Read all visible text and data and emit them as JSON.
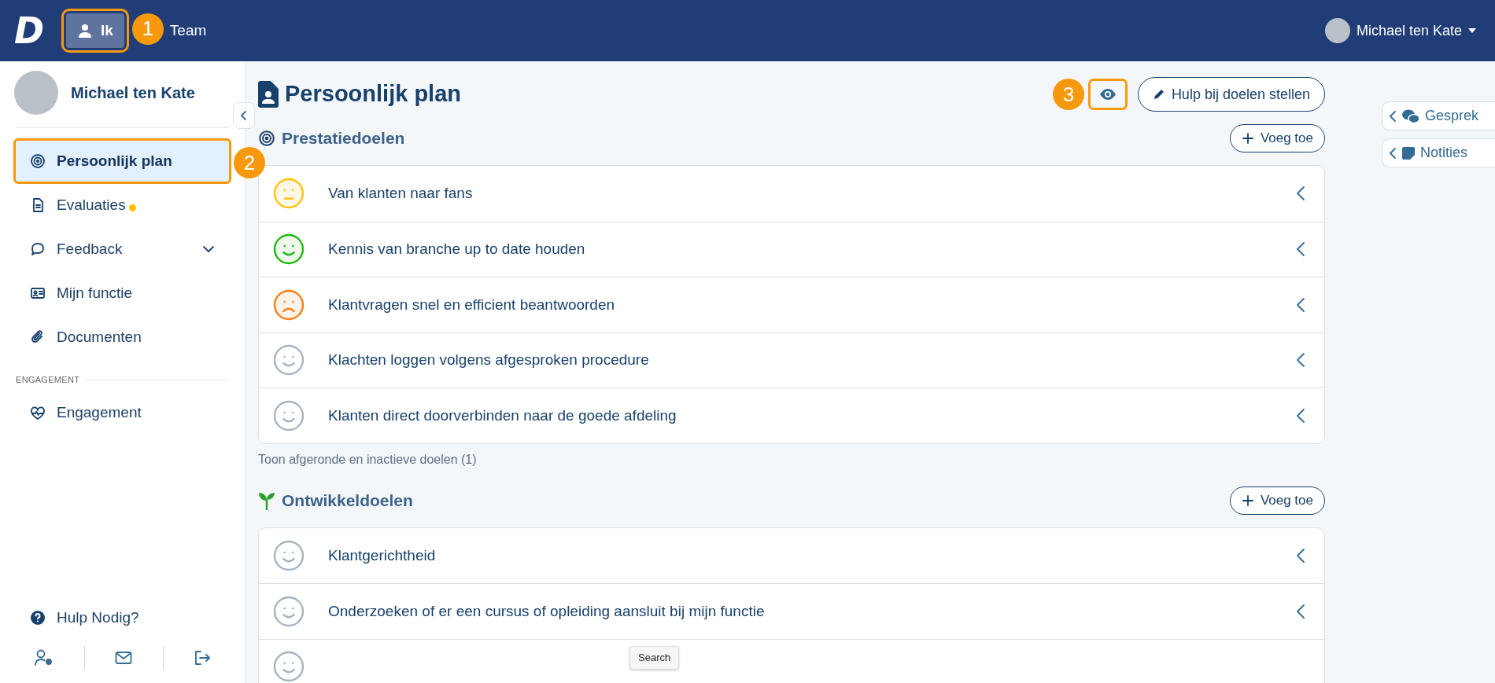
{
  "topbar": {
    "logo": "D",
    "nav": [
      {
        "label": "Ik",
        "selected": true,
        "highlighted": true
      },
      {
        "label": "Team",
        "selected": false
      }
    ],
    "user": {
      "name": "Michael ten Kate"
    }
  },
  "sidebar": {
    "profile_name": "Michael ten Kate",
    "sections": [
      {
        "items": [
          {
            "label": "Persoonlijk plan",
            "selected": true,
            "highlighted": true,
            "notification": false
          },
          {
            "label": "Evaluaties",
            "selected": false,
            "highlighted": false,
            "notification": true
          },
          {
            "label": "Feedback",
            "selected": false,
            "highlighted": false,
            "notification": false,
            "kind": "group",
            "expanded": false
          },
          {
            "label": "Mijn functie",
            "selected": false,
            "highlighted": false,
            "notification": false
          },
          {
            "label": "Documenten",
            "selected": false,
            "highlighted": false,
            "notification": false
          }
        ]
      },
      {
        "label": "ENGAGEMENT",
        "items": [
          {
            "label": "Engagement",
            "selected": false,
            "highlighted": false,
            "notification": false
          }
        ]
      }
    ],
    "help": "Hulp Nodig?"
  },
  "main": {
    "title": "Persoonlijk plan",
    "view_button": {
      "highlighted": true
    },
    "help_button": "Hulp bij doelen stellen",
    "goal_groups": [
      {
        "title": "Prestatiedoelen",
        "add_label": "Voeg toe",
        "goals": [
          {
            "title": "Van klanten naar fans",
            "kind": "neutral"
          },
          {
            "title": "Kennis van branche up to date houden",
            "kind": "good"
          },
          {
            "title": "Klantvragen snel en efficient beantwoorden",
            "kind": "bad"
          },
          {
            "title": "Klachten loggen volgens afgesproken procedure",
            "kind": "unrated"
          },
          {
            "title": "Klanten direct doorverbinden naar de goede afdeling",
            "kind": "unrated"
          }
        ],
        "footer_link": "Toon afgeronde en inactieve doelen (1)"
      },
      {
        "title": "Ontwikkeldoelen",
        "add_label": "Voeg toe",
        "goals": [
          {
            "title": "Klantgerichtheid",
            "kind": "unrated"
          },
          {
            "title": "Onderzoeken of er een cursus of opleiding aansluit bij mijn functie",
            "kind": "unrated"
          },
          {
            "kind": "unrated"
          }
        ]
      }
    ]
  },
  "side_tabs": [
    "Gesprek",
    "Notities"
  ],
  "callouts": [
    {
      "number": "1"
    },
    {
      "number": "2"
    },
    {
      "number": "3"
    }
  ],
  "tooltip": "Search"
}
